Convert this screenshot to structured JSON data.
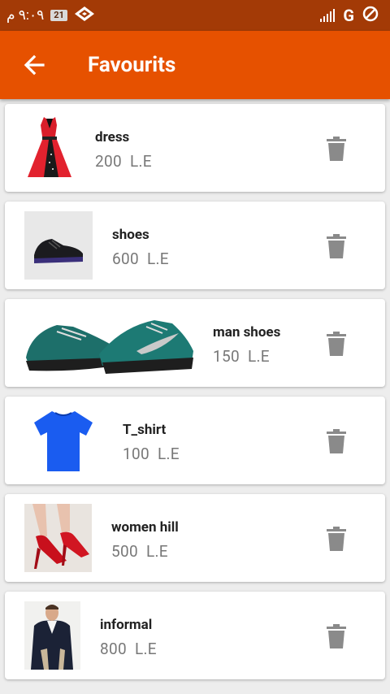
{
  "status_bar": {
    "time": "٩:٠٩ م",
    "battery": "21",
    "network": "G"
  },
  "app_bar": {
    "title": "Favourits"
  },
  "favourites": [
    {
      "name": "dress",
      "price": "200",
      "currency": "L.E",
      "image": "red-dress"
    },
    {
      "name": "shoes",
      "price": "600",
      "currency": "L.E",
      "image": "black-sneaker"
    },
    {
      "name": "man shoes",
      "price": "150",
      "currency": "L.E",
      "image": "teal-running-shoes"
    },
    {
      "name": "T_shirt",
      "price": "100",
      "currency": "L.E",
      "image": "blue-tshirt"
    },
    {
      "name": "women hill",
      "price": "500",
      "currency": "L.E",
      "image": "red-high-heels"
    },
    {
      "name": "informal",
      "price": "800",
      "currency": "L.E",
      "image": "man-in-blazer"
    }
  ],
  "colors": {
    "status_bar": "#a33a06",
    "app_bar": "#e65100",
    "price_text": "#777777",
    "delete_icon": "#8a8a8a"
  },
  "icons": {
    "back": "arrow-back-icon",
    "delete": "trash-icon"
  }
}
